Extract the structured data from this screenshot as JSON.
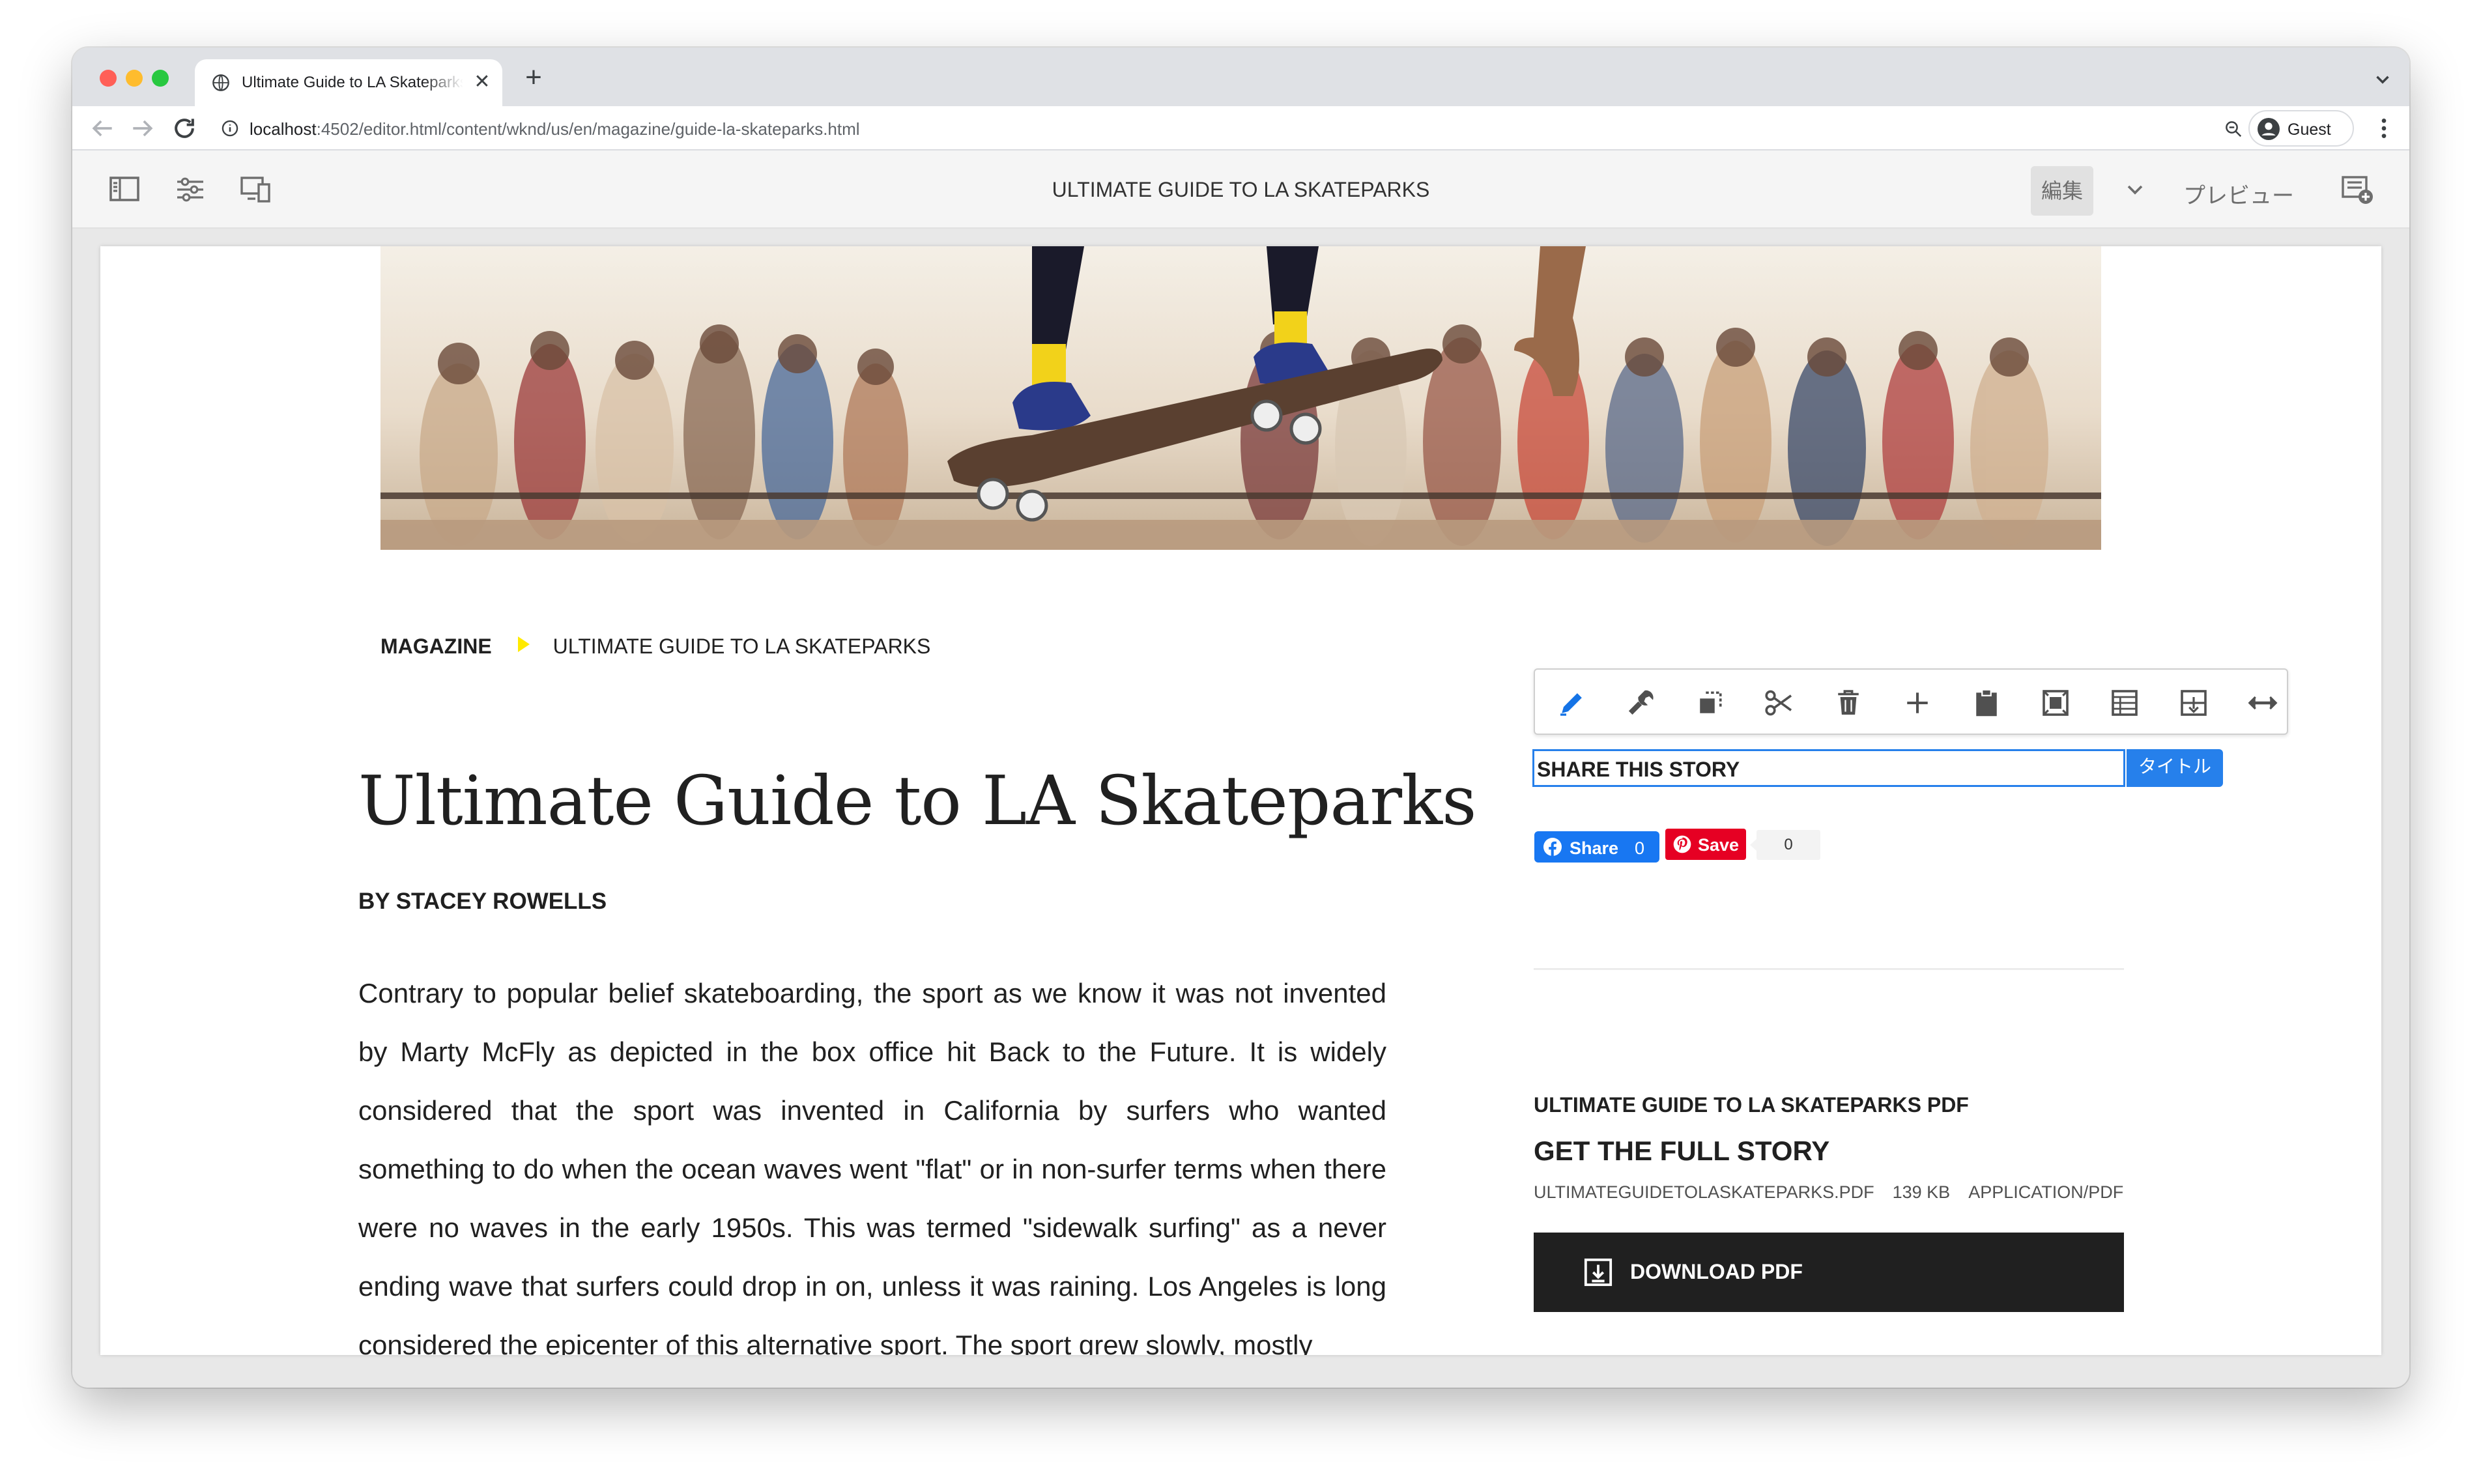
{
  "browser": {
    "tab_title": "Ultimate Guide to LA Skateparks",
    "tab_close": "✕",
    "new_tab": "+",
    "url_host": "localhost",
    "url_path": ":4502/editor.html/content/wknd/us/en/magazine/guide-la-skateparks.html",
    "profile_name": "Guest"
  },
  "editor": {
    "page_title": "ULTIMATE GUIDE TO LA SKATEPARKS",
    "mode_edit": "編集",
    "mode_preview": "プレビュー"
  },
  "article": {
    "breadcrumb": [
      "MAGAZINE",
      "ULTIMATE GUIDE TO LA SKATEPARKS"
    ],
    "title": "Ultimate Guide to LA Skateparks",
    "byline": "BY STACEY ROWELLS",
    "body": "Contrary to popular belief skateboarding, the sport as we know it was not invented by Marty McFly as depicted in the box office hit Back to the Future. It is widely considered that the sport was invented in California by surfers who wanted something to do when the ocean waves went \"flat\" or in non-surfer terms when there were no waves in the early 1950s. This was termed \"sidewalk surfing\" as a never ending wave that surfers could drop in on, unless it was raining. Los Angeles is long considered the epicenter of this alternative sport. The sport grew slowly, mostly"
  },
  "component_toolbar": {
    "icons": [
      "pencil-icon",
      "wrench-icon",
      "copy-icon",
      "scissors-icon",
      "trash-icon",
      "plus-icon",
      "clipboard-icon",
      "group-icon",
      "layout-icon",
      "insert-icon",
      "resize-icon"
    ]
  },
  "share": {
    "title": "SHARE THIS STORY",
    "badge": "タイトル",
    "fb_label": "Share",
    "fb_count": "0",
    "pin_label": "Save",
    "pin_count": "0"
  },
  "download": {
    "heading": "ULTIMATE GUIDE TO LA SKATEPARKS PDF",
    "title": "GET THE FULL STORY",
    "filename": "ULTIMATEGUIDETOLASKATEPARKS.PDF",
    "size": "139 KB",
    "mime": "APPLICATION/PDF",
    "button_label": "DOWNLOAD PDF"
  },
  "colors": {
    "accent_blue": "#2680eb",
    "breadcrumb_arrow": "#ffea00",
    "facebook": "#1877f2",
    "pinterest": "#e60023",
    "download_button": "#202020"
  }
}
